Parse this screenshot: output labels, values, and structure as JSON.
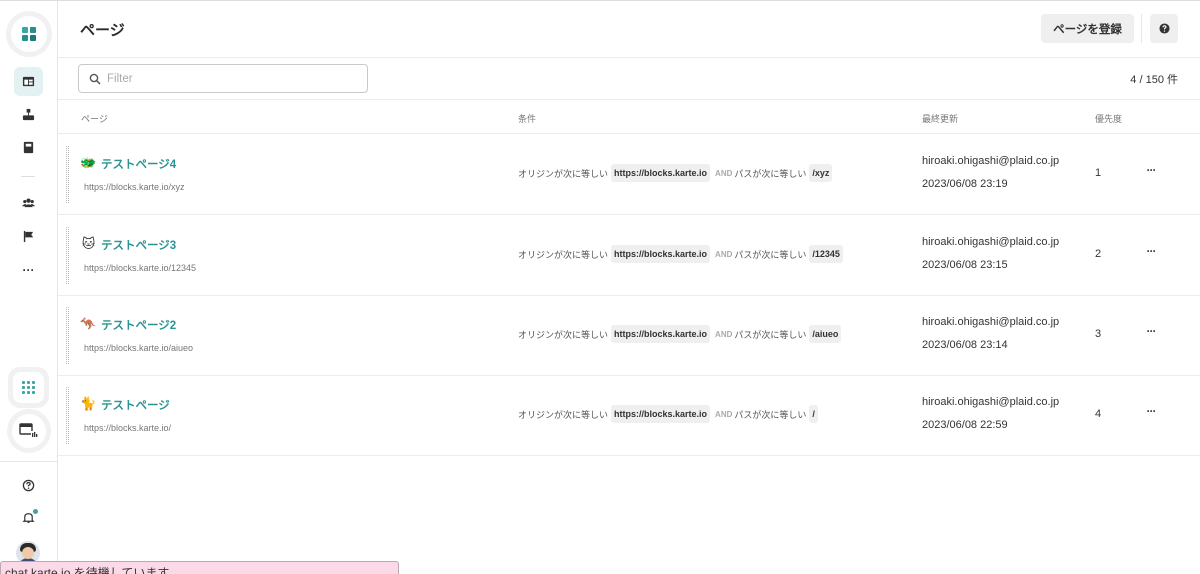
{
  "header": {
    "title": "ページ",
    "register_label": "ページを登録"
  },
  "filter": {
    "placeholder": "Filter",
    "value": ""
  },
  "count": "4 / 150 件",
  "columns": {
    "page": "ページ",
    "condition": "条件",
    "updated": "最終更新",
    "priority": "優先度"
  },
  "rows": [
    {
      "emoji": "🐲",
      "name": "テストページ4",
      "url": "https://blocks.karte.io/xyz",
      "cond_origin_label": "オリジンが次に等しい",
      "origin": "https://blocks.karte.io",
      "and": "AND",
      "cond_path_label": "パスが次に等しい",
      "path": "/xyz",
      "owner": "hiroaki.ohigashi@plaid.co.jp",
      "updated": "2023/06/08 23:19",
      "priority": "1",
      "more": "···"
    },
    {
      "emoji": "🐱",
      "name": "テストページ3",
      "url": "https://blocks.karte.io/12345",
      "cond_origin_label": "オリジンが次に等しい",
      "origin": "https://blocks.karte.io",
      "and": "AND",
      "cond_path_label": "パスが次に等しい",
      "path": "/12345",
      "owner": "hiroaki.ohigashi@plaid.co.jp",
      "updated": "2023/06/08 23:15",
      "priority": "2",
      "more": "···"
    },
    {
      "emoji": "🦘",
      "name": "テストページ2",
      "url": "https://blocks.karte.io/aiueo",
      "cond_origin_label": "オリジンが次に等しい",
      "origin": "https://blocks.karte.io",
      "and": "AND",
      "cond_path_label": "パスが次に等しい",
      "path": "/aiueo",
      "owner": "hiroaki.ohigashi@plaid.co.jp",
      "updated": "2023/06/08 23:14",
      "priority": "3",
      "more": "···"
    },
    {
      "emoji": "🐈",
      "name": "テストページ",
      "url": "https://blocks.karte.io/",
      "cond_origin_label": "オリジンが次に等しい",
      "origin": "https://blocks.karte.io",
      "and": "AND",
      "cond_path_label": "パスが次に等しい",
      "path": "/",
      "owner": "hiroaki.ohigashi@plaid.co.jp",
      "updated": "2023/06/08 22:59",
      "priority": "4",
      "more": "···"
    }
  ],
  "sidebar": {
    "more_label": "···",
    "icons": [
      "logo-icon",
      "page-layout-icon",
      "sitemap-icon",
      "book-icon",
      "users-icon",
      "flag-icon",
      "more-icon",
      "apps-grid-icon",
      "page-block-icon",
      "help-icon",
      "bell-icon",
      "avatar"
    ]
  },
  "statusbar": {
    "text": "chat.karte.io を待機しています..."
  },
  "colors": {
    "accent": "#2a9490",
    "active_nav_bg": "#e3f1f3",
    "status_bg": "#fbd9e6"
  }
}
